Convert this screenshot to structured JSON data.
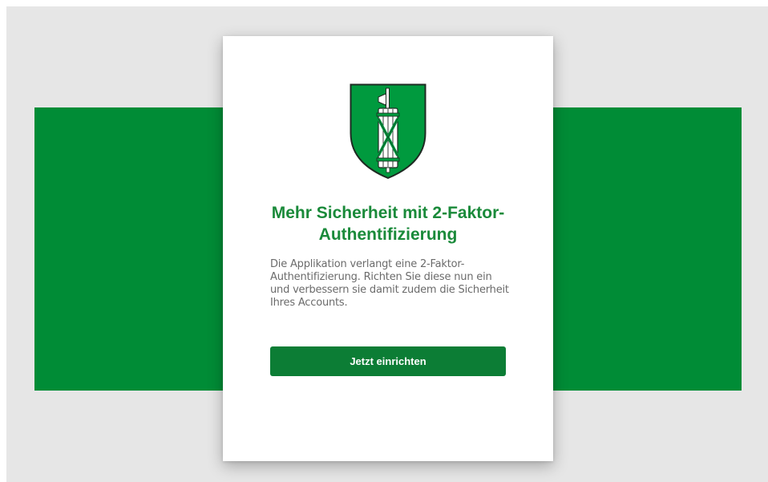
{
  "colors": {
    "brand_green": "#008c36",
    "title_green": "#1a8a3a",
    "button_green": "#0c7d35",
    "page_background": "#e6e6e6",
    "body_text": "#6b6b6b"
  },
  "logo": {
    "icon": "st-gallen-coat-of-arms-icon"
  },
  "card": {
    "title": "Mehr Sicherheit mit 2-Faktor-Authentifizierung",
    "description": "Die Applikation verlangt eine 2-Faktor-Authentifizierung. Richten Sie diese nun ein und verbessern sie damit zudem die Sicherheit Ihres Accounts.",
    "button_label": "Jetzt einrichten"
  }
}
